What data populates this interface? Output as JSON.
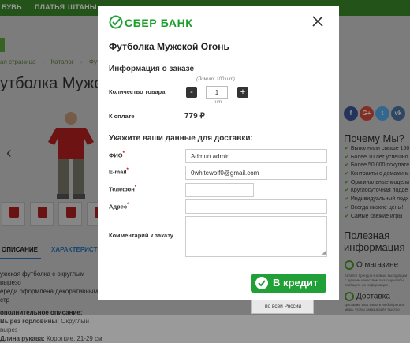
{
  "background_page": {
    "topnav": [
      "БУВЬ",
      "ПЛАТЬЯ",
      "ШТАНЫ"
    ],
    "breadcrumbs": [
      "ая страница",
      "Каталог",
      "Футболки"
    ],
    "product_title": "утболка Мужс",
    "tabs": {
      "description": "ОПИСАНИЕ",
      "characteristics": "ХАРАКТЕРИСТИКИ"
    },
    "description_lines": [
      "ужская футболка с округлым вырезо",
      "ереди оформлена декоративными стр"
    ],
    "extra_desc_heading": "ополнительное описание:",
    "neck_label": "Вырез горловины:",
    "neck_value": "Округлый вырез",
    "sleeve_label": "Длина рукава:",
    "sleeve_value": "Короткие, 21-29 см",
    "socials": [
      "f",
      "G+",
      "t",
      "vk"
    ],
    "why_us_heading": "Почему Мы?",
    "why_us_items": [
      "Выполнили свыше 150",
      "Более 10 лет успешно",
      "Более 50 000 покупате",
      "Контракты с домами м",
      "Оригинальные модели",
      "Круглосуточная подде",
      "Индивидуальный подх",
      "Всегда низкие цены!",
      "Самые свежие игры"
    ],
    "useful_heading": "Полезная информация",
    "about_link": "О магазине",
    "about_text": "Каталог брендов к новым выходящим с лучшим качеством поэтому чтобы сообщите на информация",
    "delivery_link": "Доставка",
    "delivery_text": "Доставим ваш заказ в любой регион мира, чтобы заказ дошёл быстро",
    "russia_badge": "по всей России",
    "colors": {
      "nav": "#3b8a2a",
      "accent_blue": "#2a73b8",
      "shirt": "#b02020"
    }
  },
  "modal": {
    "brand": "СБЕР БАНК",
    "product_name": "Футболка Мужской Огонь",
    "order_info_heading": "Информация о заказе",
    "quantity_limit": "(Лимит: 100 шт)",
    "quantity_label": "Количество товара",
    "quantity_value": "1",
    "quantity_unit": "шт",
    "minus": "-",
    "plus": "+",
    "total_label": "К оплате",
    "total_value": "779 ₽",
    "delivery_heading": "Укажите ваши данные для доставки:",
    "fields": {
      "name_label": "ФИО",
      "name_value": "Admun admin",
      "email_label": "E-mail",
      "email_value": "0whitewolf0@gmail.com",
      "phone_label": "Телефон",
      "phone_value": "",
      "address_label": "Адрес",
      "address_value": "",
      "comment_label": "Комментарий к заказу",
      "required_mark": "*"
    },
    "credit_button": "В кредит",
    "colors": {
      "brand_green": "#21a038",
      "required": "#cc0000"
    }
  }
}
